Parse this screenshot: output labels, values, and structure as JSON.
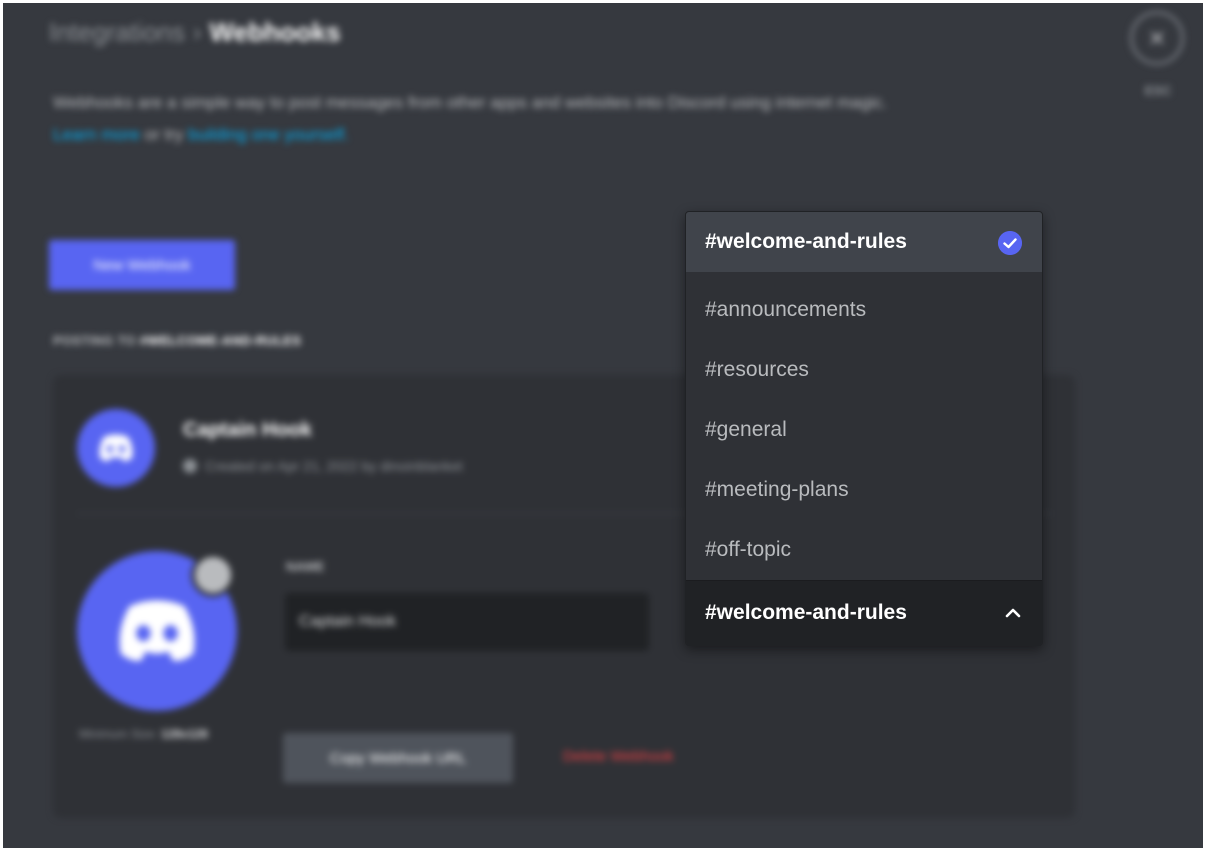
{
  "settings": {
    "breadcrumb_parent": "Integrations",
    "breadcrumb_separator": "›",
    "breadcrumb_current": "Webhooks",
    "close_label": "ESC",
    "description": "Webhooks are a simple way to post messages from other apps and websites into Discord using internet magic.",
    "learn_more_link": "Learn more",
    "description_middle": "or try",
    "build_link": "building one yourself.",
    "new_webhook_button": "New Webhook",
    "posting_to_prefix": "POSTING TO",
    "posting_to_channel": "#WELCOME-AND-RULES",
    "webhook": {
      "name": "Captain Hook",
      "meta": "Created on Apr 21, 2022 by dinoinblanket",
      "name_label": "NAME",
      "name_value": "Captain Hook",
      "min_size_prefix": "Minimum Size:",
      "min_size_value": "128x128",
      "copy_url_button": "Copy Webhook URL",
      "delete_button": "Delete Webhook"
    }
  },
  "dropdown": {
    "options": [
      {
        "label": "#welcome-and-rules",
        "selected": true
      },
      {
        "label": "#announcements",
        "selected": false
      },
      {
        "label": "#resources",
        "selected": false
      },
      {
        "label": "#general",
        "selected": false
      },
      {
        "label": "#meeting-plans",
        "selected": false
      },
      {
        "label": "#off-topic",
        "selected": false
      }
    ],
    "current_value": "#welcome-and-rules",
    "indicator_icon": "chevron-up-icon",
    "selected_icon": "check-circle-icon"
  },
  "colors": {
    "background": "#36393f",
    "card": "#2f3136",
    "blurple": "#5865f2",
    "danger": "#ed4245",
    "link": "#00aff4"
  }
}
